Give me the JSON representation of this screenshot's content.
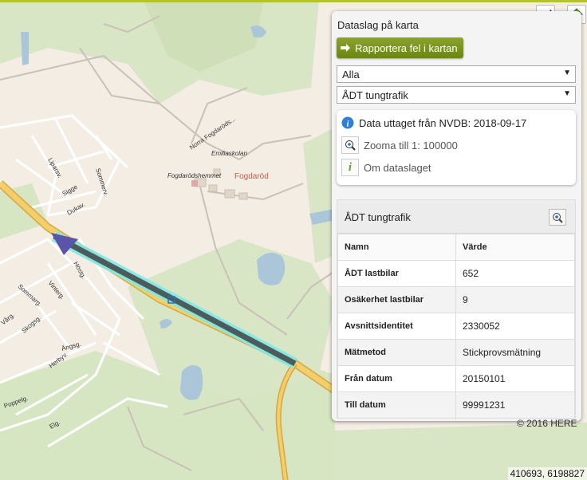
{
  "panel": {
    "title": "Dataslag på karta",
    "report_button": "Rapportera fel i kartan",
    "select_category": "Alla",
    "select_layer": "ÅDT tungtrafik",
    "source_text": "Data uttaget från NVDB: 2018-09-17",
    "zoom_text": "Zooma till 1: 100000",
    "about_text": "Om dataslaget"
  },
  "attributes": {
    "title": "ÅDT tungtrafik",
    "columns": [
      "Namn",
      "Värde"
    ],
    "rows": [
      [
        "ÅDT lastbilar",
        "652"
      ],
      [
        "Osäkerhet lastbilar",
        "9"
      ],
      [
        "Avsnittsidentitet",
        "2330052"
      ],
      [
        "Mätmetod",
        "Stickprovsmätning"
      ],
      [
        "Från datum",
        "20150101"
      ],
      [
        "Till datum",
        "99991231"
      ]
    ]
  },
  "map": {
    "labels": {
      "norra": "Norra Fogdaröds...",
      "emilia": "Emiliaskolan",
      "hemmet": "Fogdarödshemmet",
      "place": "Fogdaröd",
      "lidan": "Liparsv.",
      "sigge": "Sigge",
      "solr": "Sommerv.",
      "drake": "Dukav.",
      "hostg": "Höstg.",
      "vinterg": "Vinterg.",
      "sommarg": "Sommarg.",
      "skogsg": "Skogsg.",
      "varg": "Vårg.",
      "angsg": "Ängsg.",
      "herbyv": "Herbyv.",
      "poppelg": "Poppelg.",
      "elg": "Elg."
    },
    "copyright": "© 2016 HERE",
    "coordinates": "410693, 6198827",
    "colors": {
      "highway": "#f0c25a",
      "selected_road": "#4c5c5c",
      "highlight": "#7ee8e4",
      "water": "#aac6d8",
      "forest": "#cfe0b8"
    }
  }
}
